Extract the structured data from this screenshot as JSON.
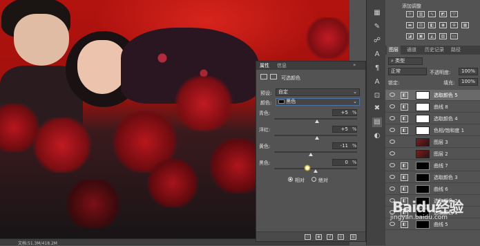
{
  "status_bar": {
    "doc_info": "文档:51.3M/418.2M"
  },
  "adjustments": {
    "title": "添加调整"
  },
  "layers_panel": {
    "tabs": [
      "图层",
      "通道",
      "历史记录",
      "路径"
    ],
    "filter_kind": "类型",
    "blend_mode": "正常",
    "opacity_label": "不透明度:",
    "opacity_value": "100%",
    "lock_label": "锁定:",
    "fill_label": "填充:",
    "fill_value": "100%",
    "layers": [
      {
        "name": "选取颜色 5",
        "thumb": "white",
        "selected": true
      },
      {
        "name": "曲线 8",
        "thumb": "white",
        "selected": false
      },
      {
        "name": "选取颜色 4",
        "thumb": "white",
        "selected": false
      },
      {
        "name": "色相/饱和度 1",
        "thumb": "white",
        "selected": false
      },
      {
        "name": "图层 3",
        "thumb": "photo",
        "selected": false
      },
      {
        "name": "图层 2",
        "thumb": "photo",
        "selected": false
      },
      {
        "name": "曲线 7",
        "thumb": "black",
        "selected": false
      },
      {
        "name": "选取颜色 3",
        "thumb": "black",
        "selected": false
      },
      {
        "name": "曲线 6",
        "thumb": "black",
        "selected": false
      },
      {
        "name": "选取颜色 2",
        "thumb": "black",
        "selected": false
      },
      {
        "name": "选取颜色 1",
        "thumb": "black",
        "selected": false
      },
      {
        "name": "曲线 5",
        "thumb": "black",
        "selected": false
      }
    ]
  },
  "properties": {
    "tabs": [
      "属性",
      "信息"
    ],
    "title": "可选颜色",
    "preset_label": "预设:",
    "preset_value": "自定",
    "colors_label": "颜色:",
    "colors_value": "黑色",
    "sliders": [
      {
        "label": "青色:",
        "value": "+5",
        "unit": "%",
        "level": 0.52
      },
      {
        "label": "洋红:",
        "value": "+5",
        "unit": "%",
        "level": 0.52
      },
      {
        "label": "黄色:",
        "value": "-11",
        "unit": "%",
        "level": 0.44
      },
      {
        "label": "黑色:",
        "value": "0",
        "unit": "%",
        "level": 0.5
      }
    ],
    "mode_relative": "相对",
    "mode_absolute": "绝对",
    "mode_selected": "relative"
  },
  "watermark": {
    "line1": "Baidu经验",
    "line2": "jingyan.baidu.com"
  }
}
